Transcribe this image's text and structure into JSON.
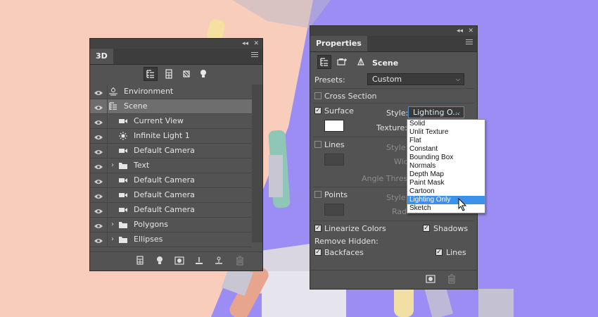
{
  "colors": {
    "panel_bg": "#535353",
    "bg_peach": "#f8cdbc",
    "bg_purple": "#9b8df3",
    "selection_blue": "#3e91e8"
  },
  "panel3d": {
    "tab_label": "3D",
    "toolbar_icons": [
      "scene-filter-icon",
      "mesh-filter-icon",
      "material-filter-icon",
      "light-filter-icon"
    ],
    "layers": [
      {
        "name": "Environment",
        "icon": "environment-icon",
        "eye": true,
        "indent": 0,
        "expandable": false,
        "selected": false
      },
      {
        "name": "Scene",
        "icon": "scene-icon",
        "eye": true,
        "indent": 0,
        "expandable": false,
        "selected": true
      },
      {
        "name": "Current View",
        "icon": "camera-icon",
        "eye": true,
        "indent": 1,
        "expandable": false,
        "selected": false
      },
      {
        "name": "Infinite Light 1",
        "icon": "light-icon",
        "eye": true,
        "indent": 1,
        "expandable": false,
        "selected": false
      },
      {
        "name": "Default Camera",
        "icon": "camera-icon",
        "eye": true,
        "indent": 1,
        "expandable": false,
        "selected": false
      },
      {
        "name": "Text",
        "icon": "folder-icon",
        "eye": true,
        "indent": 1,
        "expandable": true,
        "selected": false
      },
      {
        "name": "Default Camera",
        "icon": "camera-icon",
        "eye": true,
        "indent": 1,
        "expandable": false,
        "selected": false
      },
      {
        "name": "Default Camera",
        "icon": "camera-icon",
        "eye": true,
        "indent": 1,
        "expandable": false,
        "selected": false
      },
      {
        "name": "Default Camera",
        "icon": "camera-icon",
        "eye": true,
        "indent": 1,
        "expandable": false,
        "selected": false
      },
      {
        "name": "Polygons",
        "icon": "folder-icon",
        "eye": true,
        "indent": 1,
        "expandable": true,
        "selected": false
      },
      {
        "name": "Ellipses",
        "icon": "folder-icon",
        "eye": true,
        "indent": 1,
        "expandable": true,
        "selected": false
      }
    ],
    "bottom_icons": [
      "new-mesh-icon",
      "new-light-icon",
      "render-icon",
      "ground-plane-icon",
      "drop-to-plane-icon",
      "trash-icon"
    ]
  },
  "properties": {
    "tab_label": "Properties",
    "header_label": "Scene",
    "presets_label": "Presets:",
    "presets_value": "Custom",
    "cross_section_label": "Cross Section",
    "cross_section_checked": false,
    "surface_label": "Surface",
    "surface_checked": true,
    "style_label": "Style:",
    "surface_style_value": "Lighting O...",
    "texture_label": "Texture:",
    "lines_label": "Lines",
    "lines_checked": false,
    "lines_style_label": "Style:",
    "width_label": "Wid",
    "angle_label": "Angle Thresh",
    "points_label": "Points",
    "points_checked": false,
    "points_style_label": "Style:",
    "radius_label": "Radi",
    "linearize_label": "Linearize Colors",
    "linearize_checked": true,
    "shadows_label": "Shadows",
    "shadows_checked": true,
    "remove_hidden_label": "Remove Hidden:",
    "backfaces_label": "Backfaces",
    "backfaces_checked": true,
    "lines2_label": "Lines",
    "lines2_checked": true
  },
  "style_dropdown": {
    "options": [
      "Solid",
      "Unlit Texture",
      "Flat",
      "Constant",
      "Bounding Box",
      "Normals",
      "Depth Map",
      "Paint Mask",
      "Cartoon",
      "Lighting Only",
      "Sketch"
    ],
    "selected_index": 9
  },
  "window_controls": {
    "collapse": "◂◂",
    "close": "✕"
  }
}
